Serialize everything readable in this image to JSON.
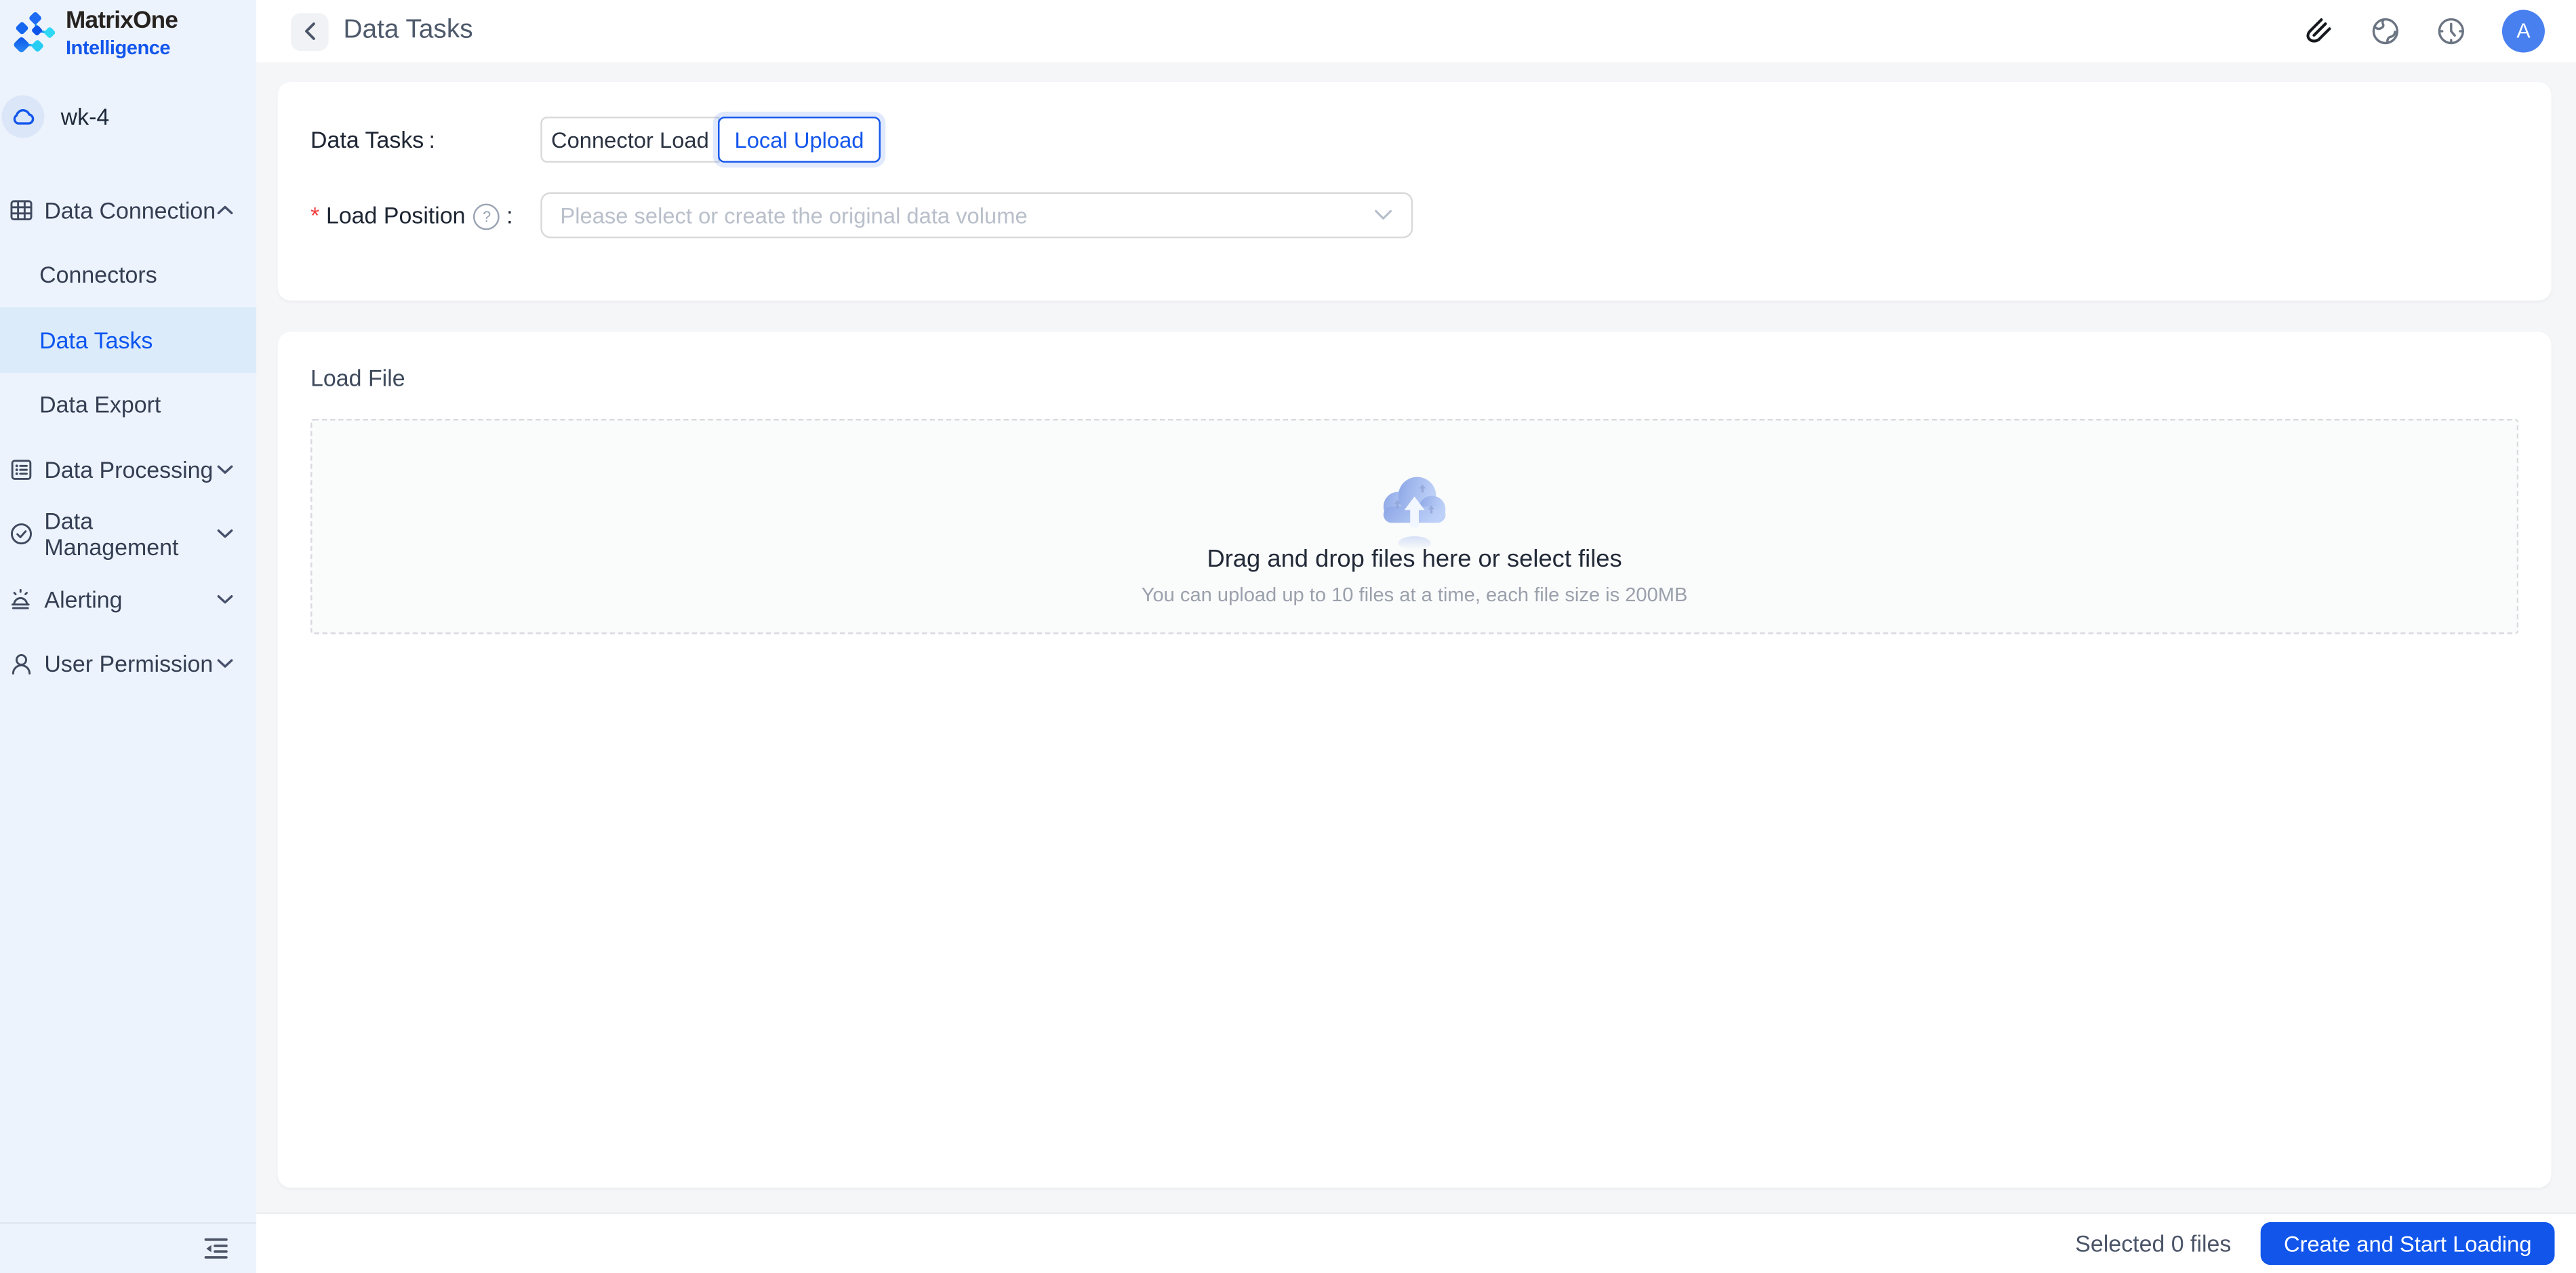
{
  "brand": {
    "name": "MatrixOne",
    "sub": "Intelligence"
  },
  "workspace": {
    "name": "wk-4"
  },
  "sidebar": {
    "items": [
      {
        "label": "Data Connection",
        "expanded": true
      },
      {
        "label": "Connectors"
      },
      {
        "label": "Data Tasks",
        "active": true
      },
      {
        "label": "Data Export"
      },
      {
        "label": "Data Processing",
        "expanded": false
      },
      {
        "label": "Data Management",
        "expanded": false
      },
      {
        "label": "Alerting",
        "expanded": false
      },
      {
        "label": "User Permission",
        "expanded": false
      }
    ]
  },
  "header": {
    "title": "Data Tasks",
    "avatar_initial": "A"
  },
  "form": {
    "data_tasks_label": "Data Tasks",
    "colon": ":",
    "required_mark": "*",
    "help_mark": "?",
    "toggle": {
      "connector": "Connector Load",
      "local": "Local Upload",
      "selected": "Local Upload"
    },
    "load_position_label": "Load Position",
    "load_position_placeholder": "Please select or create the original data volume"
  },
  "upload": {
    "section_title": "Load File",
    "drop_title": "Drag and drop files here or select files",
    "drop_hint": "You can upload up to 10 files at a time, each file size is 200MB"
  },
  "footer": {
    "selected_text": "Selected 0 files",
    "submit_label": "Create and Start Loading"
  },
  "icons": {
    "sidebar": [
      "cloud-icon",
      "table-grid-icon",
      "list-doc-icon",
      "check-circle-icon",
      "alert-siren-icon",
      "user-icon",
      "collapse-sidebar-icon"
    ],
    "header": [
      "back-chevron-icon",
      "paperclip-icon",
      "globe-icon",
      "clock-icon"
    ],
    "main": [
      "help-icon",
      "chevron-down-icon",
      "upload-cloud-icon"
    ]
  },
  "colors": {
    "primary": "#1155eb",
    "avatar_bg": "#4880f0",
    "sidebar_bg": "#edf3fc",
    "sidebar_active_bg": "#dcebfa",
    "main_bg": "#f5f6f8",
    "required_red": "#f23c3c"
  }
}
